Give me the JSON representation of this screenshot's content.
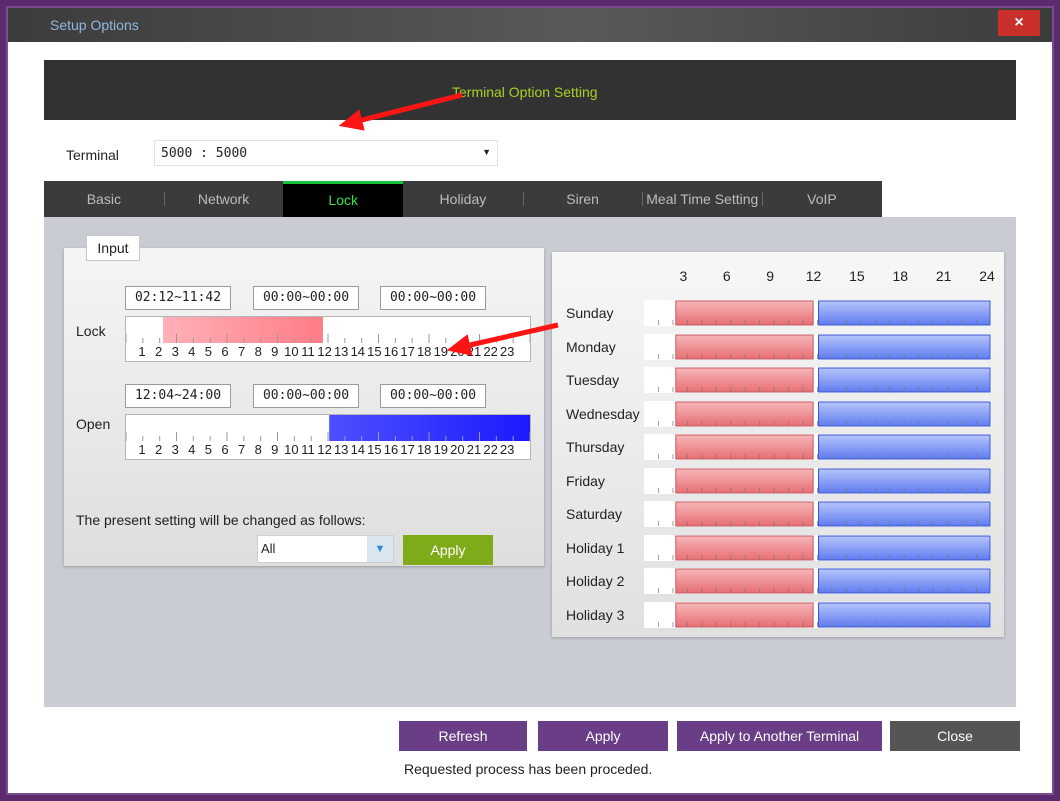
{
  "window": {
    "title": "Setup Options",
    "close_label": "×"
  },
  "header": {
    "title": "Terminal Option Setting"
  },
  "terminal": {
    "label": "Terminal",
    "value": "5000 : 5000"
  },
  "tabs": [
    {
      "label": "Basic",
      "active": false
    },
    {
      "label": "Network",
      "active": false
    },
    {
      "label": "Lock",
      "active": true
    },
    {
      "label": "Holiday",
      "active": false
    },
    {
      "label": "Siren",
      "active": false
    },
    {
      "label": "Meal Time Setting",
      "active": false
    },
    {
      "label": "VoIP",
      "active": false
    }
  ],
  "input_panel": {
    "tab_label": "Input",
    "lock": {
      "label": "Lock",
      "ranges": [
        "02:12~11:42",
        "00:00~00:00",
        "00:00~00:00"
      ],
      "highlight_hours": [
        2.2,
        11.7
      ],
      "color": "#ff7c86"
    },
    "open": {
      "label": "Open",
      "ranges": [
        "12:04~24:00",
        "00:00~00:00",
        "00:00~00:00"
      ],
      "highlight_hours": [
        12.07,
        24
      ],
      "color": "#1a1aff"
    },
    "hour_numbers": [
      "1",
      "2",
      "3",
      "4",
      "5",
      "6",
      "7",
      "8",
      "9",
      "10",
      "11",
      "12",
      "13",
      "14",
      "15",
      "16",
      "17",
      "18",
      "19",
      "20",
      "21",
      "22",
      "23"
    ],
    "change_text": "The present setting will be changed as follows:",
    "apply_to_value": "All",
    "apply_label": "Apply"
  },
  "weekly_schedule": {
    "hour_labels": [
      "3",
      "6",
      "9",
      "12",
      "15",
      "18",
      "21",
      "24"
    ],
    "days": [
      "Sunday",
      "Monday",
      "Tuesday",
      "Wednesday",
      "Thursday",
      "Friday",
      "Saturday",
      "Holiday 1",
      "Holiday 2",
      "Holiday 3"
    ],
    "lock_hours": [
      2.2,
      11.7
    ],
    "open_hours": [
      12.07,
      24
    ],
    "lock_color": "#e76f73",
    "open_color": "#5e7cf0"
  },
  "buttons": {
    "refresh": "Refresh",
    "apply": "Apply",
    "apply_other": "Apply to Another Terminal",
    "close": "Close"
  },
  "status": "Requested process has been proceded.",
  "annotation_color": "#ff1414"
}
